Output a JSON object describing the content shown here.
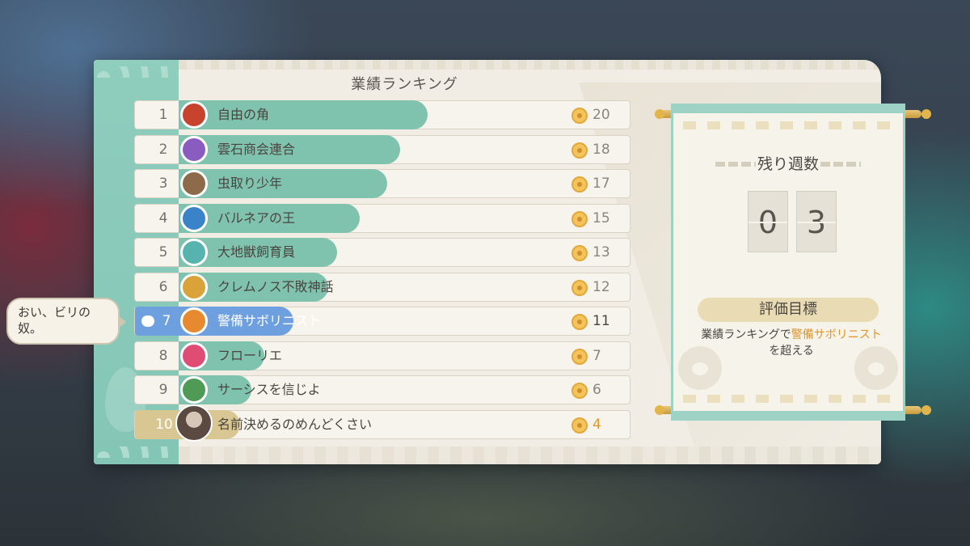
{
  "panel": {
    "title": "業績ランキング"
  },
  "ranking": [
    {
      "rank": "1",
      "name": "自由の角",
      "score": "20",
      "fill": 0.55,
      "emblem_color": "#c8432e",
      "icon": "flame-emblem-icon"
    },
    {
      "rank": "2",
      "name": "雲石商会連合",
      "score": "18",
      "fill": 0.49,
      "emblem_color": "#8a5cc0",
      "icon": "cloud-emblem-icon"
    },
    {
      "rank": "3",
      "name": "虫取り少年",
      "score": "17",
      "fill": 0.46,
      "emblem_color": "#8c6a4a",
      "icon": "bug-emblem-icon"
    },
    {
      "rank": "4",
      "name": "バルネアの王",
      "score": "15",
      "fill": 0.4,
      "emblem_color": "#3b83c9",
      "icon": "bath-emblem-icon"
    },
    {
      "rank": "5",
      "name": "大地獣飼育員",
      "score": "13",
      "fill": 0.35,
      "emblem_color": "#56b3ad",
      "icon": "beast-emblem-icon"
    },
    {
      "rank": "6",
      "name": "クレムノス不敗神話",
      "score": "12",
      "fill": 0.33,
      "emblem_color": "#d9a33a",
      "icon": "spear-emblem-icon"
    },
    {
      "rank": "7",
      "name": "警備サボリニスト",
      "score": "11",
      "fill": 0.3,
      "emblem_color": "#e6892f",
      "icon": "guard-emblem-icon"
    },
    {
      "rank": "8",
      "name": "フローリエ",
      "score": "7",
      "fill": 0.19,
      "emblem_color": "#e04d74",
      "icon": "flower-emblem-icon"
    },
    {
      "rank": "9",
      "name": "サーシスを信じよ",
      "score": "6",
      "fill": 0.16,
      "emblem_color": "#4f9a55",
      "icon": "leaf-emblem-icon"
    },
    {
      "rank": "10",
      "name": "名前決めるのめんどくさい",
      "score": "4",
      "fill": 0.11,
      "emblem_color": "#5b4a42",
      "icon": "player-avatar-icon"
    }
  ],
  "bubble": {
    "text_line1": "おい、ビリの",
    "text_line2": "奴。"
  },
  "weeks": {
    "label": "残り週数",
    "digit1": "0",
    "digit2": "3"
  },
  "goal": {
    "label": "評価目標",
    "text_pre": "業績ランキングで",
    "text_highlight": "警備サボリニスト",
    "text_post": "を超える"
  },
  "colors": {
    "accent_teal": "#8fcdbd",
    "active_blue": "#6e9fde",
    "highlight_orange": "#e0952b",
    "self_gold": "#d9c793"
  }
}
